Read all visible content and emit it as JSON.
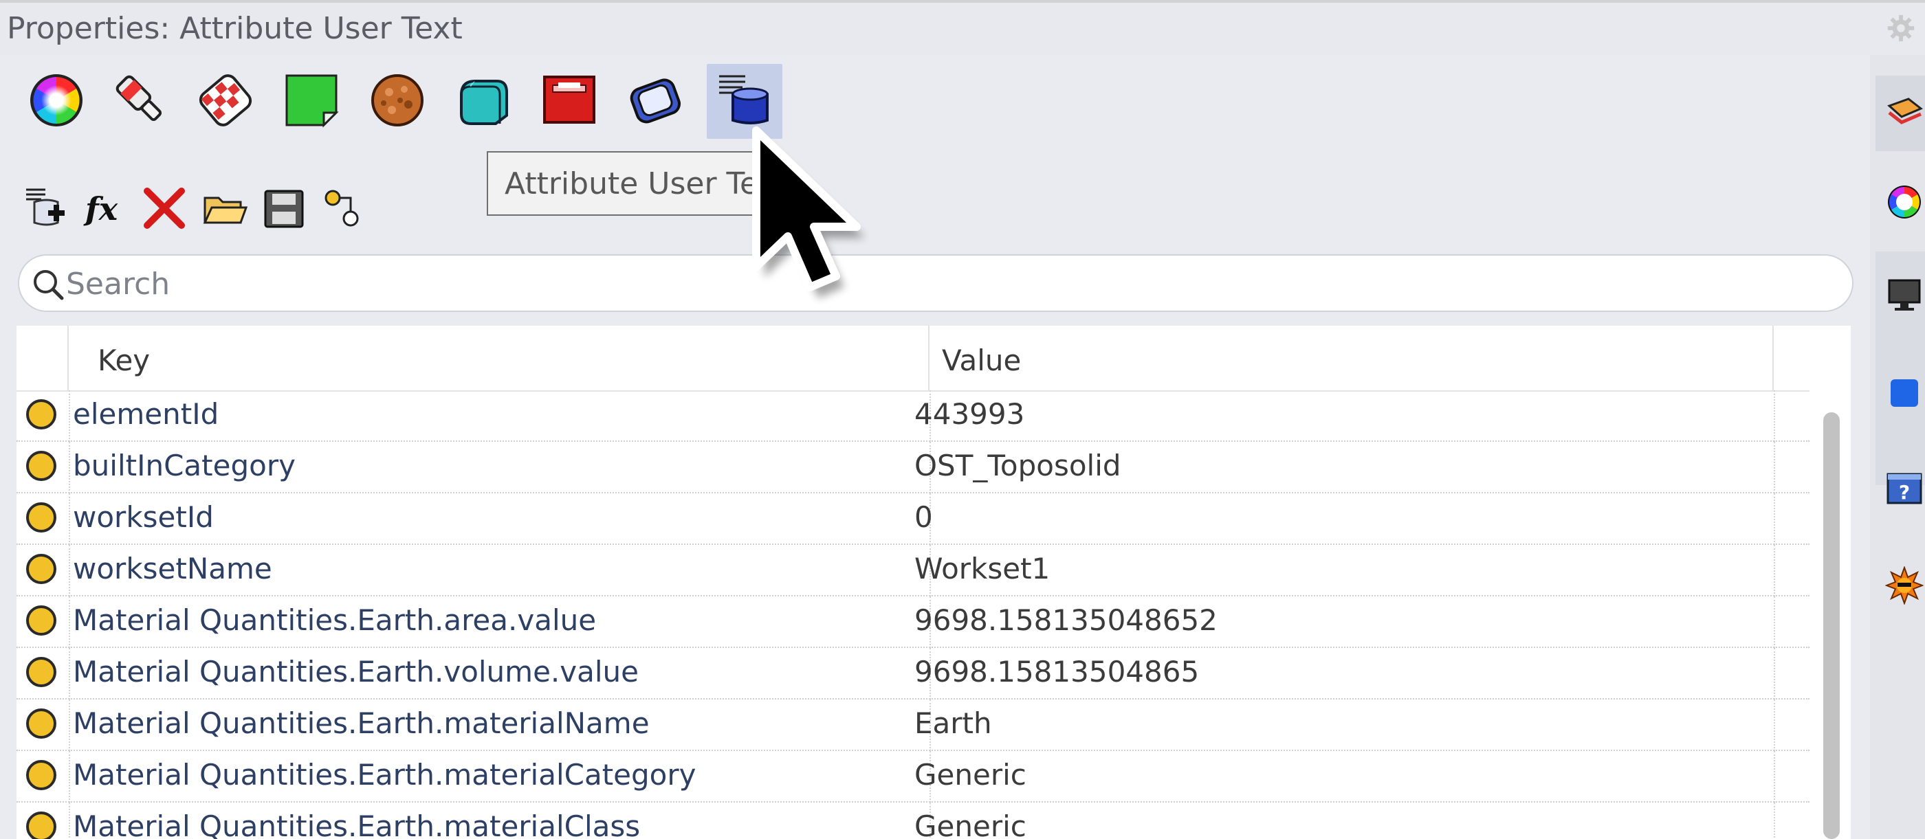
{
  "window": {
    "title": "Properties: Attribute User Text"
  },
  "panel_tabs": [
    {
      "icon": "color-wheel-icon",
      "label": "Object"
    },
    {
      "icon": "material-paint-icon",
      "label": "Material"
    },
    {
      "icon": "texture-mapping-icon",
      "label": "Texture Mapping"
    },
    {
      "icon": "decal-icon",
      "label": "Decal"
    },
    {
      "icon": "displacement-icon",
      "label": "Displacement"
    },
    {
      "icon": "edge-softening-icon",
      "label": "Edge Softening"
    },
    {
      "icon": "curve-piping-icon",
      "label": "Curve Piping"
    },
    {
      "icon": "shut-lining-icon",
      "label": "Shut Lining"
    },
    {
      "icon": "attribute-user-text-icon",
      "label": "Attribute User Text"
    }
  ],
  "tooltip": {
    "text": "Attribute User Tex"
  },
  "toolbar": [
    {
      "icon": "add-key-icon"
    },
    {
      "icon": "function-icon",
      "text": "fx"
    },
    {
      "icon": "delete-icon"
    },
    {
      "icon": "open-folder-icon"
    },
    {
      "icon": "save-icon"
    },
    {
      "icon": "link-key-icon"
    }
  ],
  "search": {
    "placeholder": "Search"
  },
  "table": {
    "columns": [
      "Key",
      "Value"
    ],
    "rows": [
      {
        "key": "elementId",
        "value": "443993"
      },
      {
        "key": "builtInCategory",
        "value": "OST_Toposolid"
      },
      {
        "key": "worksetId",
        "value": "0"
      },
      {
        "key": "worksetName",
        "value": "Workset1"
      },
      {
        "key": "Material Quantities.Earth.area.value",
        "value": "9698.158135048652"
      },
      {
        "key": "Material Quantities.Earth.volume.value",
        "value": "9698.15813504865"
      },
      {
        "key": "Material Quantities.Earth.materialName",
        "value": "Earth"
      },
      {
        "key": "Material Quantities.Earth.materialCategory",
        "value": "Generic"
      },
      {
        "key": "Material Quantities.Earth.materialClass",
        "value": "Generic"
      }
    ]
  },
  "side_panel": [
    {
      "icon": "layers-icon"
    },
    {
      "icon": "color-wheel-icon"
    },
    {
      "icon": "display-icon"
    },
    {
      "icon": "blue-square-icon"
    },
    {
      "icon": "help-icon"
    },
    {
      "icon": "sun-icon"
    }
  ],
  "colors": {
    "row_dot": "#f2c028",
    "active_tab": "#c5d0e8",
    "key_text": "#2e3f64"
  }
}
